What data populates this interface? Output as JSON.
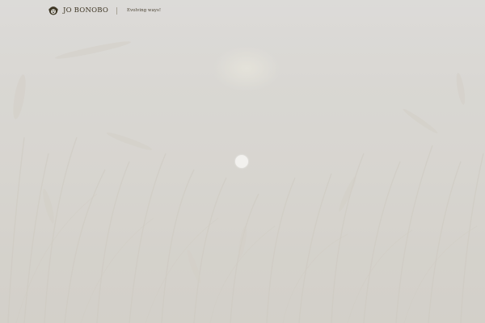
{
  "header": {
    "brand_name": "JO BONOBO",
    "tagline": "Evolving ways!",
    "logo_icon": "bonobo-face-icon"
  },
  "hero": {
    "background": "misty-wheat-field",
    "loading_indicator": "spinner-dot"
  },
  "colors": {
    "brand_text": "#3d3523",
    "haze": "#dad9d4",
    "spinner": "#f2f1ee"
  }
}
